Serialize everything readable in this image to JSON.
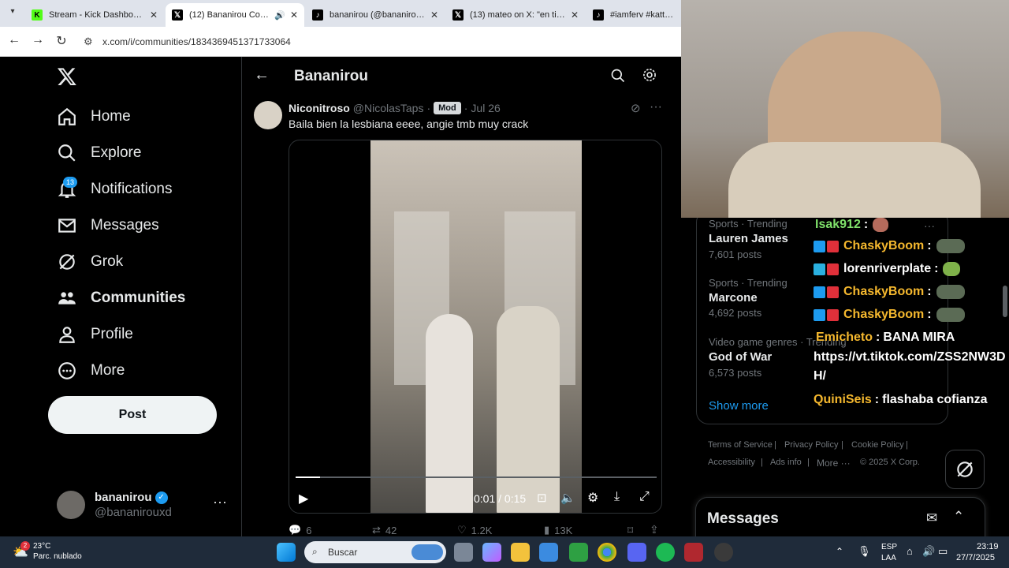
{
  "browser": {
    "tabs": [
      {
        "title": "Stream - Kick Dashboard",
        "favicon": "kick-icon",
        "color": "#53fc18"
      },
      {
        "title": "(12) Bananirou Commu",
        "favicon": "x-icon",
        "color": "#000000"
      },
      {
        "title": "bananirou (@bananirouwt",
        "favicon": "tiktok-icon",
        "color": "#000000"
      },
      {
        "title": "(13) mateo on X: \"en tiktok",
        "favicon": "x-icon",
        "color": "#000000"
      },
      {
        "title": "#iamferv #katteyes #",
        "favicon": "tiktok-icon",
        "color": "#000000"
      }
    ],
    "url": "x.com/i/communities/1834369451371733064"
  },
  "sidebar": {
    "logo": "x-logo-icon",
    "items": [
      {
        "label": "Home",
        "icon": "home-icon"
      },
      {
        "label": "Explore",
        "icon": "search-icon"
      },
      {
        "label": "Notifications",
        "icon": "bell-icon",
        "badge": "13"
      },
      {
        "label": "Messages",
        "icon": "mail-icon"
      },
      {
        "label": "Grok",
        "icon": "grok-icon"
      },
      {
        "label": "Communities",
        "icon": "communities-icon"
      },
      {
        "label": "Profile",
        "icon": "person-icon"
      },
      {
        "label": "More",
        "icon": "more-circle-icon"
      }
    ],
    "post_label": "Post",
    "account": {
      "name": "bananirou",
      "handle": "@bananirouxd"
    }
  },
  "community": {
    "title": "Bananirou"
  },
  "post": {
    "author": "Niconitroso",
    "handle": "@NicolasTaps",
    "separator": "·",
    "role_badge": "Mod",
    "date": "Jul 26",
    "text": "Baila bien la lesbiana eeee, angie tmb muy crack",
    "video": {
      "time": "0:01 / 0:15",
      "progress": 0.067
    },
    "stats": {
      "replies": "6",
      "reposts": "42",
      "likes": "1.2K",
      "views": "13K"
    }
  },
  "trends": [
    {
      "category": "Sports · Trending",
      "name": "Lauren James",
      "count": "7,601 posts"
    },
    {
      "category": "Sports · Trending",
      "name": "Marcone",
      "count": "4,692 posts"
    },
    {
      "category": "Video game genres · Trending",
      "name": "God of War",
      "count": "6,573 posts"
    }
  ],
  "show_more": "Show more",
  "footer": {
    "links": [
      "Terms of Service",
      "Privacy Policy",
      "Cookie Policy",
      "Accessibility",
      "Ads info",
      "More ···"
    ],
    "copyright": "© 2025 X Corp."
  },
  "messages_panel": {
    "title": "Messages"
  },
  "chat": [
    {
      "user": "Isak912",
      "sep": ":",
      "text": "",
      "color": "#7fe06a"
    },
    {
      "user": "ChaskyBoom",
      "sep": ":",
      "text": "",
      "color": "#f5b82e"
    },
    {
      "user": "lorenriverplate",
      "sep": ":",
      "text": "",
      "color": "#ffffff"
    },
    {
      "user": "ChaskyBoom",
      "sep": ":",
      "text": "",
      "color": "#f5b82e"
    },
    {
      "user": "ChaskyBoom",
      "sep": ":",
      "text": "",
      "color": "#f5b82e"
    },
    {
      "user": "Emicheto",
      "sep": ":",
      "text": "BANA MIRA",
      "color": "#f5b82e"
    },
    {
      "user": "",
      "sep": "",
      "text": "https://vt.tiktok.com/ZSS2NW3D",
      "color": "#ffffff"
    },
    {
      "user": "",
      "sep": "",
      "text": "H/",
      "color": "#ffffff"
    },
    {
      "user": "QuiniSeis",
      "sep": ":",
      "text": "flashaba cofianza",
      "color": "#f5b82e"
    }
  ],
  "taskbar": {
    "weather_badge": "2",
    "temp": "23°C",
    "condition": "Parc. nublado",
    "search_placeholder": "Buscar",
    "lang_top": "ESP",
    "lang_bottom": "LAA",
    "time": "23:19",
    "date": "27/7/2025"
  }
}
